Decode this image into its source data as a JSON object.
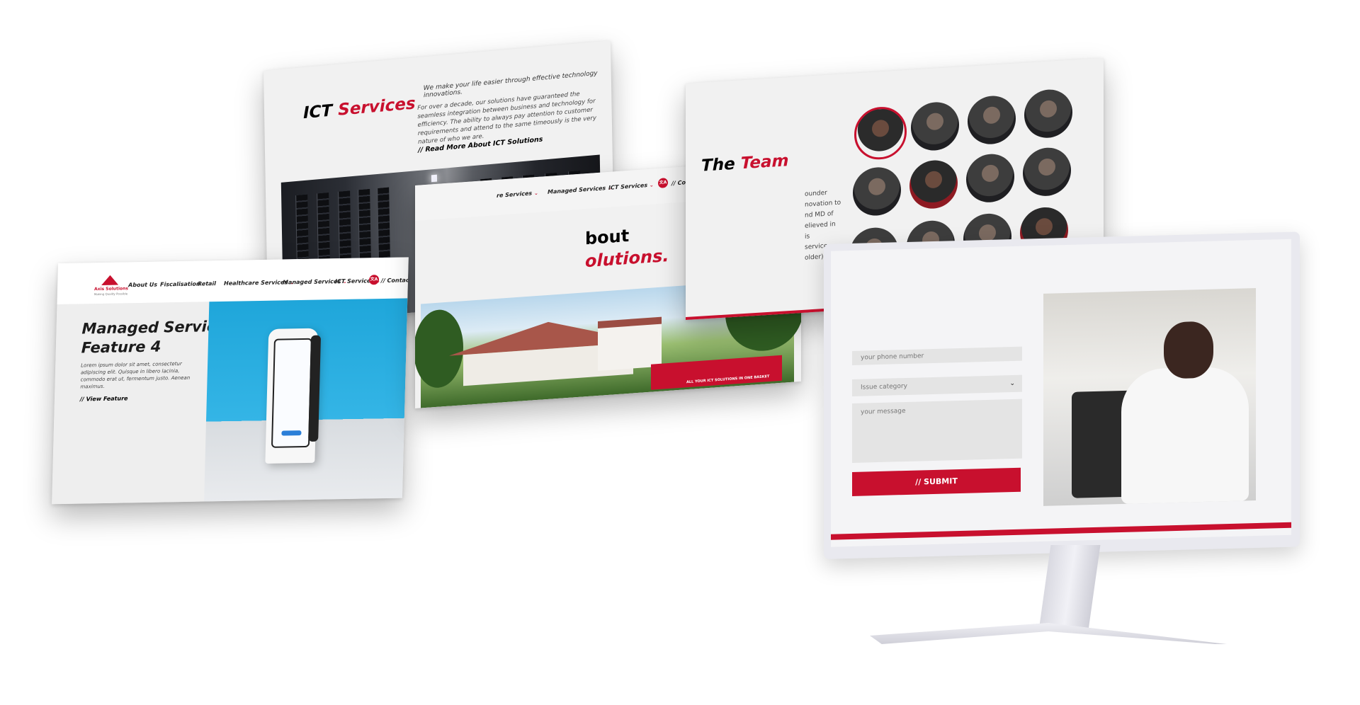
{
  "ict_panel": {
    "title_prefix": "ICT",
    "title_suffix": "Services",
    "tagline": "We make your life easier through effective technology innovations.",
    "body": "For over a decade, our solutions have guaranteed the seamless integration between business and technology for efficiency. The ability to always pay attention to customer requirements and attend to the same timeously is the very nature of who we are.",
    "read_more": "// Read More About ICT Solutions"
  },
  "managed_panel": {
    "logo_wordmark": "Axis Solutions",
    "logo_tagline": "Making Quality Possible",
    "nav": {
      "about": "About Us",
      "fiscal": "Fiscalisation",
      "retail": "Retail",
      "healthcare": "Healthcare Services",
      "managed": "Managed Services",
      "ict": "ICT Services",
      "lang": "文A",
      "contact": "// Contact Us"
    },
    "hero_title_1": "Managed Service",
    "hero_title_2": "Feature 4",
    "hero_body": "Lorem ipsum dolor sit amet, consectetur adipiscing elit. Quisque in libero lacinia, commodo erat ut, fermentum justo. Aenean maximus.",
    "hero_link": "// View Feature"
  },
  "about_panel": {
    "nav": {
      "healthcare": "re Services",
      "managed": "Managed Services",
      "ict": "ICT Services",
      "lang": "文A",
      "contact": "// Contact Us"
    },
    "heading_1": "bout",
    "heading_2": "olutions.",
    "banner_text": "ALL YOUR ICT SOLUTIONS IN ONE BASKET"
  },
  "team_panel": {
    "title_prefix": "The",
    "title_suffix": "Team",
    "snippet_lines": [
      "ounder",
      "novation to",
      "nd MD of",
      "elieved in",
      "is",
      "service",
      "older) . In"
    ]
  },
  "contact_form": {
    "phone_placeholder": "your phone number",
    "category_placeholder": "Issue category",
    "message_placeholder": "your message",
    "submit_label": "// SUBMIT"
  },
  "colors": {
    "brand_red": "#c8102e",
    "panel_bg": "#f1f1f1",
    "hero_blue": "#1fa6da"
  }
}
